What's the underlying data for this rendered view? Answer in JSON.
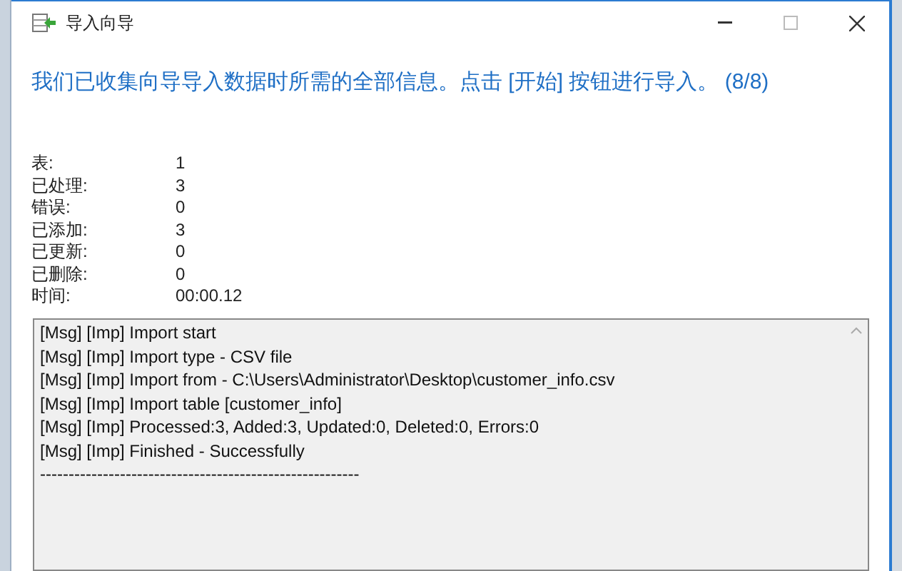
{
  "window": {
    "title": "导入向导"
  },
  "heading": "我们已收集向导导入数据时所需的全部信息。点击 [开始] 按钮进行导入。 (8/8)",
  "stats": [
    {
      "label": "表:",
      "value": "1"
    },
    {
      "label": "已处理:",
      "value": "3"
    },
    {
      "label": "错误:",
      "value": "0"
    },
    {
      "label": "已添加:",
      "value": "3"
    },
    {
      "label": "已更新:",
      "value": "0"
    },
    {
      "label": "已删除:",
      "value": "0"
    },
    {
      "label": "时间:",
      "value": "00:00.12"
    }
  ],
  "log": [
    "[Msg] [Imp] Import start",
    "[Msg] [Imp] Import type - CSV file",
    "[Msg] [Imp] Import from - C:\\Users\\Administrator\\Desktop\\customer_info.csv",
    "[Msg] [Imp] Import table [customer_info]",
    "[Msg] [Imp] Processed:3, Added:3, Updated:0, Deleted:0, Errors:0",
    "[Msg] [Imp] Finished - Successfully",
    "--------------------------------------------------------"
  ]
}
